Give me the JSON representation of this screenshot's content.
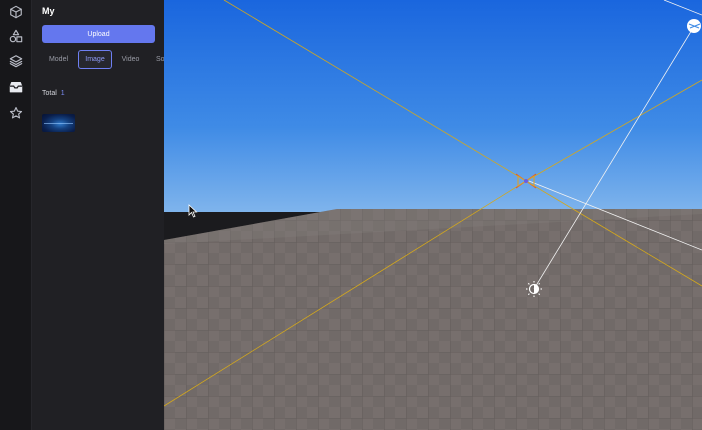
{
  "panel": {
    "title": "My",
    "upload_label": "Upload",
    "tabs": [
      {
        "label": "Model",
        "active": false
      },
      {
        "label": "Image",
        "active": true
      },
      {
        "label": "Video",
        "active": false
      },
      {
        "label": "So",
        "active": false
      }
    ],
    "total_label": "Total",
    "total_count": "1"
  },
  "rail": {
    "items": [
      {
        "icon": "cube-icon",
        "active": false
      },
      {
        "icon": "shapes-icon",
        "active": false
      },
      {
        "icon": "layers-icon",
        "active": false
      },
      {
        "icon": "archive-box-icon",
        "active": true
      },
      {
        "icon": "star-icon",
        "active": false
      }
    ]
  },
  "colors": {
    "accent": "#6477ee",
    "sky_top": "#1a66de",
    "sky_horizon": "#7fb4ec",
    "floor": "#716a68",
    "guide_line": "#d4a81c"
  }
}
